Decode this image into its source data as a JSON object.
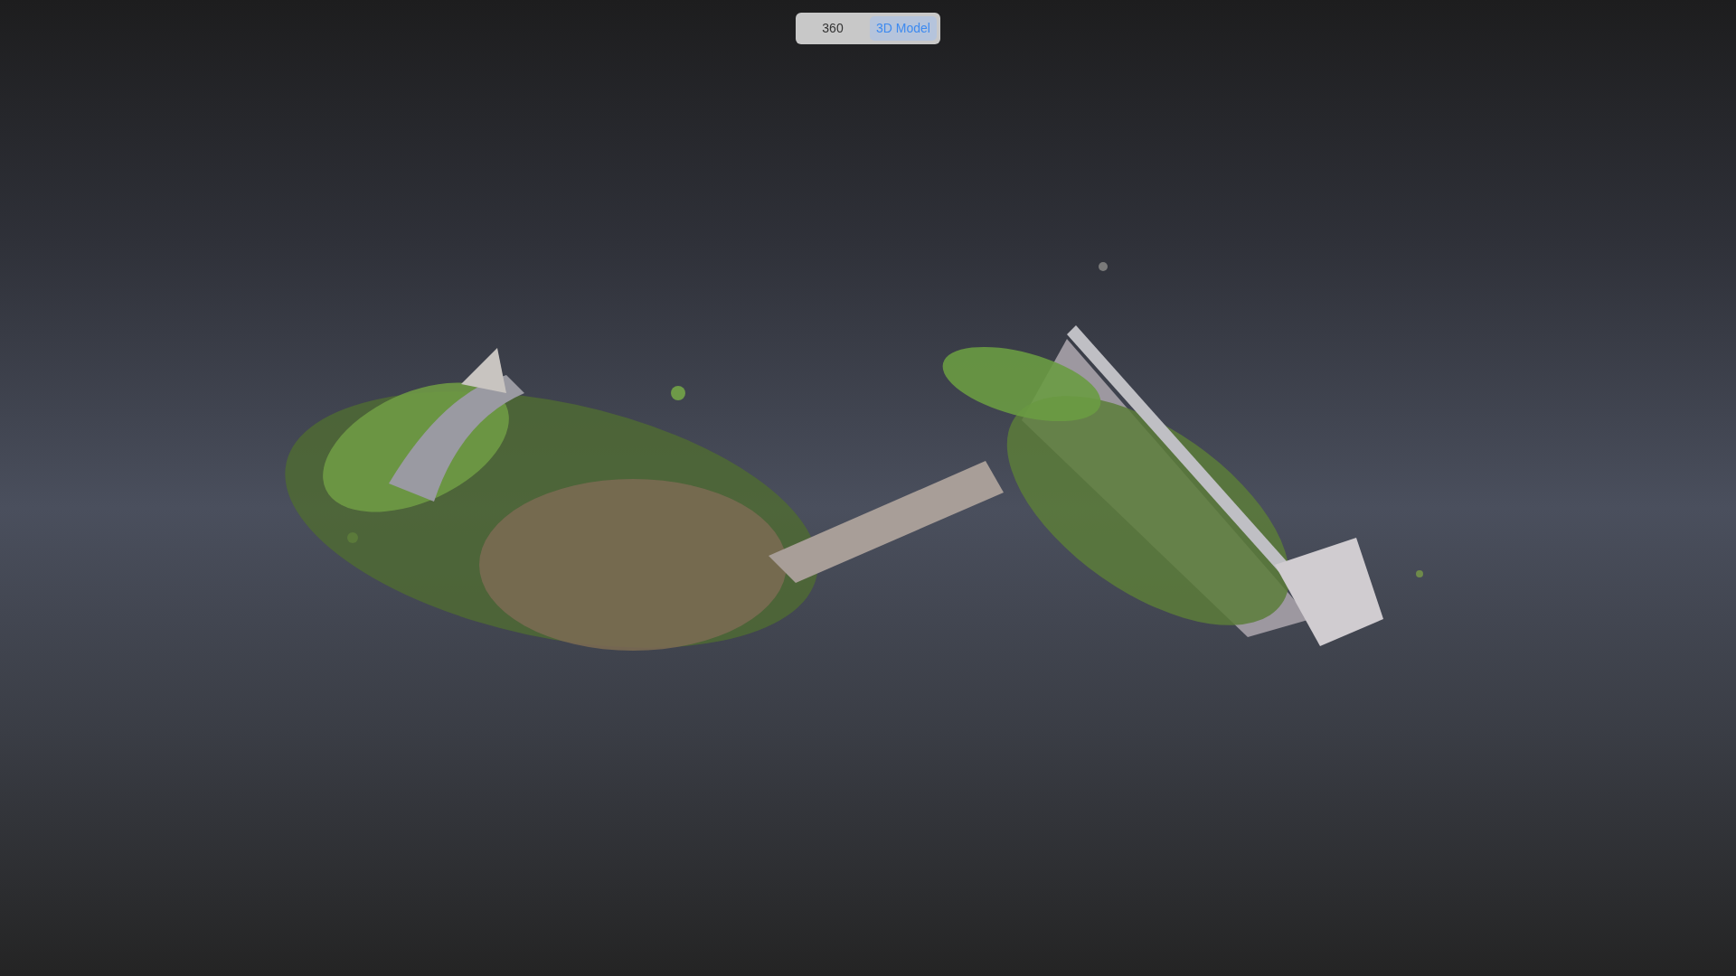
{
  "view_toggle": [
    {
      "label": "360",
      "selected": false
    },
    {
      "label": "3D Model",
      "selected": true
    }
  ]
}
